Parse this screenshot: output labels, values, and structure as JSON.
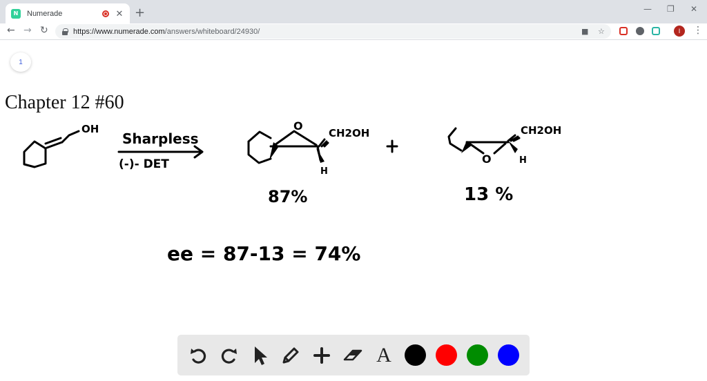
{
  "browser": {
    "tab_title": "Numerade",
    "favicon_text": "N",
    "url_host": "https://www.numerade.com",
    "url_path": "/answers/whiteboard/24930/",
    "profile_initial": "I"
  },
  "whiteboard": {
    "page_number": "1",
    "title": "Chapter 12 #60",
    "handwriting": {
      "oh_label": "OH",
      "reagent_above": "Sharpless",
      "reagent_below": "(-)- DET",
      "epoxide_o": "O",
      "ch2oh": "CH2OH",
      "h_label": "H",
      "plus": "+",
      "major_percent": "87%",
      "minor_percent": "13 %",
      "equation": "ee = 87-13 = 74%"
    }
  },
  "tools": {
    "icons": [
      "undo-icon",
      "redo-icon",
      "pointer-icon",
      "pencil-icon",
      "plus-icon",
      "eraser-icon",
      "text-icon"
    ],
    "text_tool_glyph": "A",
    "colors": [
      "#000000",
      "#ff0000",
      "#008c00",
      "#0000ff"
    ]
  }
}
